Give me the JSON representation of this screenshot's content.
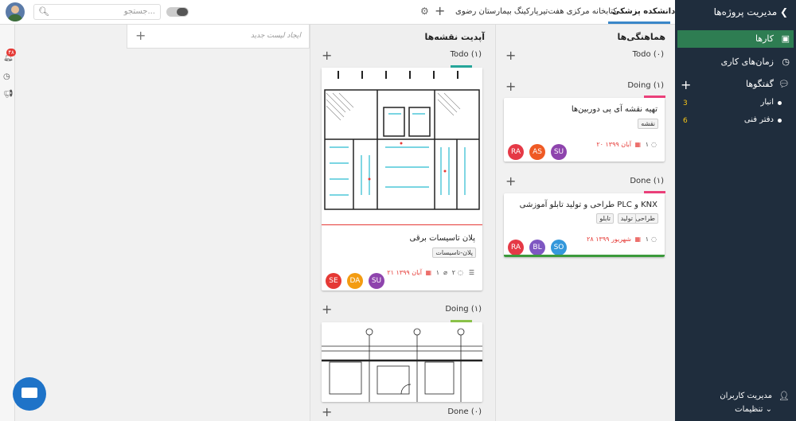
{
  "topbar": {
    "search_placeholder": "جستجو...",
    "tabs": [
      {
        "label": "دانشکده پزشکی"
      },
      {
        "label": "کتابخانه مرکزی هفت‌تیر"
      },
      {
        "label": "پارکینگ بیمارستان رضوی"
      }
    ]
  },
  "sidebar": {
    "title": "مدیریت پروژه‌ها",
    "items": [
      {
        "label": "کارها"
      },
      {
        "label": "زمان‌های کاری"
      },
      {
        "label": "گفتگوها"
      }
    ],
    "subitems": [
      {
        "label": "انبار",
        "count": "3"
      },
      {
        "label": "دفتر فنی",
        "count": "6"
      }
    ],
    "footer": {
      "users": "مدیریت کاربران",
      "settings": "تنظیمات ⌄"
    }
  },
  "left_strip": {
    "badge": "۴۸"
  },
  "lists": {
    "new_list_placeholder": "ایجاد لیست جدید",
    "coordination": {
      "title": "هماهنگی‌ها",
      "groups": [
        {
          "label": "Todo (۰)"
        },
        {
          "label": "Doing (۱)"
        },
        {
          "label": "Done (۱)"
        }
      ],
      "cards": [
        {
          "title": "تهیه نقشه آی پی دوربین‌ها",
          "tags": [
            "نقشه"
          ],
          "date": "۲۰ آبان ۱۳۹۹",
          "comments": "۱",
          "members": [
            "RA",
            "AS",
            "SU"
          ]
        },
        {
          "title": "طراحی و تولید تابلو آموزشی PLC و KNX",
          "tags": [
            "طراحی",
            "تولید",
            "تابلو"
          ],
          "date": "۲۸ شهریور ۱۳۹۹",
          "comments": "۱",
          "members": [
            "RA",
            "BL",
            "SO"
          ]
        }
      ]
    },
    "map_updates": {
      "title": "آپدیت نقشه‌ها",
      "groups": [
        {
          "label": "Todo (۱)"
        },
        {
          "label": "Doing (۱)"
        },
        {
          "label": "Done (۰)"
        }
      ],
      "cards": [
        {
          "title": "پلان تاسیسات برقی",
          "tags": [
            "پلان-تاسیسات"
          ],
          "date": "۲۱ آبان ۱۳۹۹",
          "comments": "۲",
          "attachments": "۱",
          "members": [
            "SE",
            "DA",
            "SU"
          ]
        }
      ]
    }
  },
  "colors": {
    "sidebar_bg": "#1f2d3d",
    "active_green": "#2e7d52",
    "tab_blue": "#3a87c8",
    "date_red": "#e53935",
    "label_pink": "#ec407a",
    "label_teal": "#26a69a",
    "label_lightgreen": "#8bc34a",
    "done_green": "#3c9a3c"
  },
  "icons": [
    "search-icon",
    "gear-icon",
    "plus-icon",
    "briefcase-icon",
    "clock-icon",
    "chat-icon",
    "bell-icon",
    "megaphone-icon",
    "timer-icon",
    "user-icon",
    "comment-icon",
    "calendar-icon",
    "attach-icon",
    "checklist-icon"
  ]
}
